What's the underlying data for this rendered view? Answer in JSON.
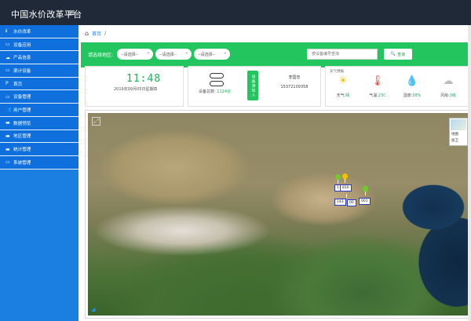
{
  "app": {
    "title": "中国水价改革平台",
    "menu_icon": "hamburger-icon"
  },
  "sidebar": {
    "items": [
      {
        "label": "水价改革",
        "icon": "info-icon"
      },
      {
        "label": "设备应用",
        "icon": "monitor-icon"
      },
      {
        "label": "产品信息",
        "icon": "cloud-icon"
      },
      {
        "label": "渠计设备",
        "icon": "monitor-icon"
      },
      {
        "label": "首页",
        "icon": "p-icon"
      },
      {
        "label": "设备管理",
        "icon": "monitor-icon"
      },
      {
        "label": "用户管理",
        "icon": "users-icon"
      },
      {
        "label": "数据预览",
        "icon": "folder-icon"
      },
      {
        "label": "地区管理",
        "icon": "folder-icon"
      },
      {
        "label": "统计管理",
        "icon": "folder-icon"
      },
      {
        "label": "系统管理",
        "icon": "monitor-icon"
      }
    ]
  },
  "breadcrumb": {
    "home": "首页",
    "separator": "/"
  },
  "filter": {
    "label": "请选择地区:",
    "selects": [
      "--请选择--",
      "--请选择--",
      "--请选择--"
    ],
    "search_placeholder": "按设备编号查询",
    "search_button": "查询"
  },
  "clock": {
    "time": "11:48",
    "date": "2019年09月05日星期四"
  },
  "devices": {
    "total_label": "设备总数:",
    "total_value": "1124台",
    "add_button": "设备添加入"
  },
  "person": {
    "name": "李国忠",
    "phone": "15372109358"
  },
  "weather": {
    "title": "天气预报",
    "items": [
      {
        "label": "天气:",
        "value": "晴",
        "icon": "sun-icon"
      },
      {
        "label": "气温:",
        "value": "23C",
        "icon": "thermometer-icon"
      },
      {
        "label": "湿度:",
        "value": "38%",
        "icon": "humidity-icon"
      },
      {
        "label": "风级:",
        "value": "3级",
        "icon": "wind-icon"
      }
    ]
  },
  "map": {
    "type_labels": [
      "地图",
      "加卫"
    ],
    "marker_labels": [
      "1",
      "810",
      "143",
      "00",
      "001"
    ]
  }
}
